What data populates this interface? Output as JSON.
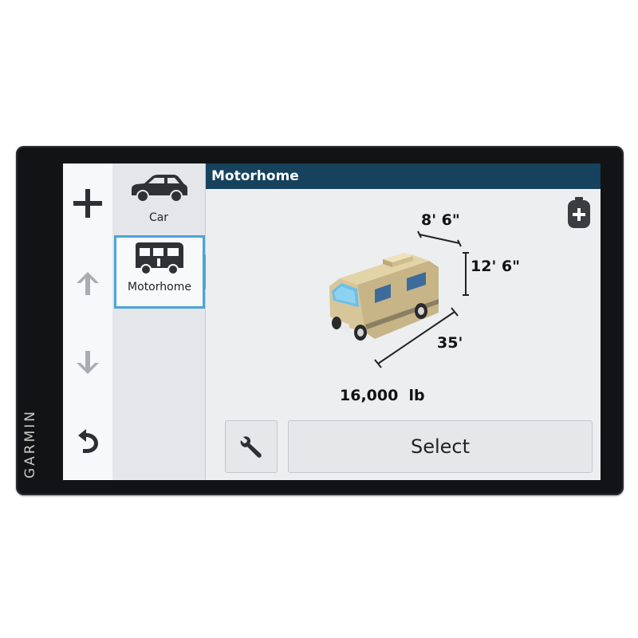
{
  "brand": "GARMIN",
  "rail": {
    "add": "add-icon",
    "up": "arrow-up-icon",
    "down": "arrow-down-icon",
    "back": "back-icon"
  },
  "profiles": [
    {
      "label": "Car",
      "icon": "car-icon",
      "selected": false
    },
    {
      "label": "Motorhome",
      "icon": "motorhome-icon",
      "selected": true
    }
  ],
  "header": {
    "title": "Motorhome"
  },
  "vehicle": {
    "width": "8' 6\"",
    "height": "12' 6\"",
    "length": "35'",
    "weight": "16,000  lb"
  },
  "actions": {
    "settings_icon": "wrench-icon",
    "select_label": "Select",
    "add_tank_icon": "propane-tank-add-icon"
  },
  "colors": {
    "header_bg": "#16425e",
    "accent": "#4ba4d8",
    "bezel": "#121315"
  }
}
